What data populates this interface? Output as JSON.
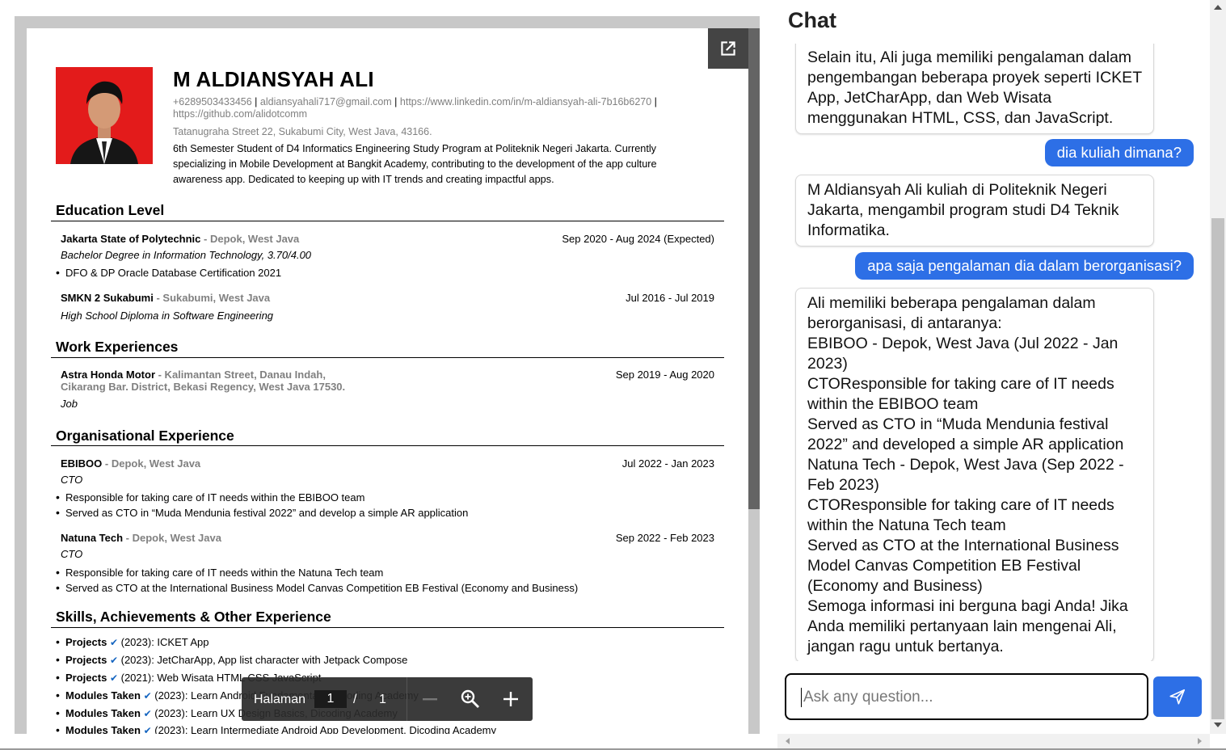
{
  "resume": {
    "name": "M ALDIANSYAH ALI",
    "phone": "+6289503433456",
    "email": "aldiansyahali717@gmail.com",
    "linkedin": "https://www.linkedin.com/in/m-aldiansyah-ali-7b16b6270",
    "github": "https://github.com/alidotcomm",
    "sep": "|",
    "address": "Tatanugraha Street 22, Sukabumi City, West Java, 43166.",
    "summary": "6th Semester Student of D4 Informatics Engineering Study Program at Politeknik Negeri Jakarta. Currently specializing in Mobile Development at Bangkit Academy, contributing to the development of the app culture awareness app. Dedicated to keeping up with IT trends and creating impactful apps.",
    "education": {
      "title": "Education Level",
      "items": [
        {
          "org": "Jakarta State of Polytechnic",
          "loc": " - Depok, West Java",
          "date": "Sep 2020 - Aug 2024 (Expected)",
          "degree": "Bachelor Degree in Information Technology, 3.70/4.00",
          "bullet": "DFO & DP Oracle Database Certification 2021"
        },
        {
          "org": "SMKN 2 Sukabumi",
          "loc": " - Sukabumi, West Java",
          "date": "Jul 2016 - Jul 2019",
          "degree": "High School Diploma in Software Engineering"
        }
      ]
    },
    "work": {
      "title": "Work Experiences",
      "items": [
        {
          "org": "Astra Honda Motor",
          "loc1": " -  Kalimantan Street, Danau Indah,",
          "loc2": "Cikarang Bar. District, Bekasi Regency, West Java 17530.",
          "date": "Sep 2019 - Aug 2020",
          "role": "Job"
        }
      ]
    },
    "org": {
      "title": "Organisational Experience",
      "items": [
        {
          "org": "EBIBOO",
          "loc": " - Depok, West Java",
          "date": "Jul 2022 - Jan 2023",
          "role": "CTO",
          "b1": "Responsible for taking care of IT needs within the EBIBOO team",
          "b2": "Served as CTO in “Muda Mendunia festival 2022” and develop a simple AR application"
        },
        {
          "org": "Natuna Tech",
          "loc": " - Depok, West Java",
          "date": "Sep 2022 - Feb 2023",
          "role": "CTO",
          "b1": "Responsible for taking care of IT needs within the Natuna Tech team",
          "b2": "Served as CTO at the International Business Model Canvas Competition EB Festival (Economy and Business)"
        }
      ]
    },
    "skills": {
      "title": "Skills, Achievements & Other Experience",
      "items": [
        {
          "label": "Projects",
          "rest": " (2023): ICKET App"
        },
        {
          "label": "Projects",
          "rest": " (2023): JetCharApp, App list character with Jetpack Compose"
        },
        {
          "label": "Projects",
          "rest": " (2021): Web Wisata HTML CSS JavaScript"
        },
        {
          "label": "Modules Taken",
          "rest": " (2023): Learn Android Fundamentals, Dicoding Academy"
        },
        {
          "label": "Modules Taken",
          "rest": " (2023): Learn UX Design Basics, Dicoding Academy"
        },
        {
          "label": "Modules Taken",
          "rest": " (2023): Learn Intermediate Android App Development, Dicoding Academy"
        }
      ]
    }
  },
  "pdf_toolbar": {
    "page_label": "Halaman",
    "current_page": "1",
    "slash": "/",
    "total_pages": "1"
  },
  "chat": {
    "title": "Chat",
    "messages": [
      {
        "role": "bot",
        "lines": [
          "Selain itu, Ali juga memiliki pengalaman dalam pengembangan beberapa proyek seperti ICKET App, JetCharApp, dan Web Wisata menggunakan HTML, CSS, dan JavaScript."
        ]
      },
      {
        "role": "user",
        "text": "dia kuliah dimana?"
      },
      {
        "role": "bot",
        "lines": [
          "M Aldiansyah Ali kuliah di Politeknik Negeri Jakarta, mengambil program studi D4 Teknik Informatika."
        ]
      },
      {
        "role": "user",
        "text": "apa saja pengalaman dia dalam berorganisasi?"
      },
      {
        "role": "bot",
        "lines": [
          "Ali memiliki beberapa pengalaman dalam berorganisasi, di antaranya:",
          "EBIBOO - Depok, West Java (Jul 2022 - Jan 2023)",
          "CTOResponsible for taking care of IT needs within the EBIBOO team",
          "Served as CTO in “Muda Mendunia festival 2022” and developed a simple AR application",
          "Natuna Tech - Depok, West Java (Sep 2022 - Feb 2023)",
          "CTOResponsible for taking care of IT needs within the Natuna Tech team",
          "Served as CTO at the International Business Model Canvas Competition EB Festival (Economy and Business)",
          "Semoga informasi ini berguna bagi Anda! Jika Anda memiliki pertanyaan lain mengenai Ali, jangan ragu untuk bertanya."
        ]
      }
    ],
    "input_placeholder": "Ask any question...",
    "input_value": "",
    "accent_color": "#2d6fe6"
  }
}
